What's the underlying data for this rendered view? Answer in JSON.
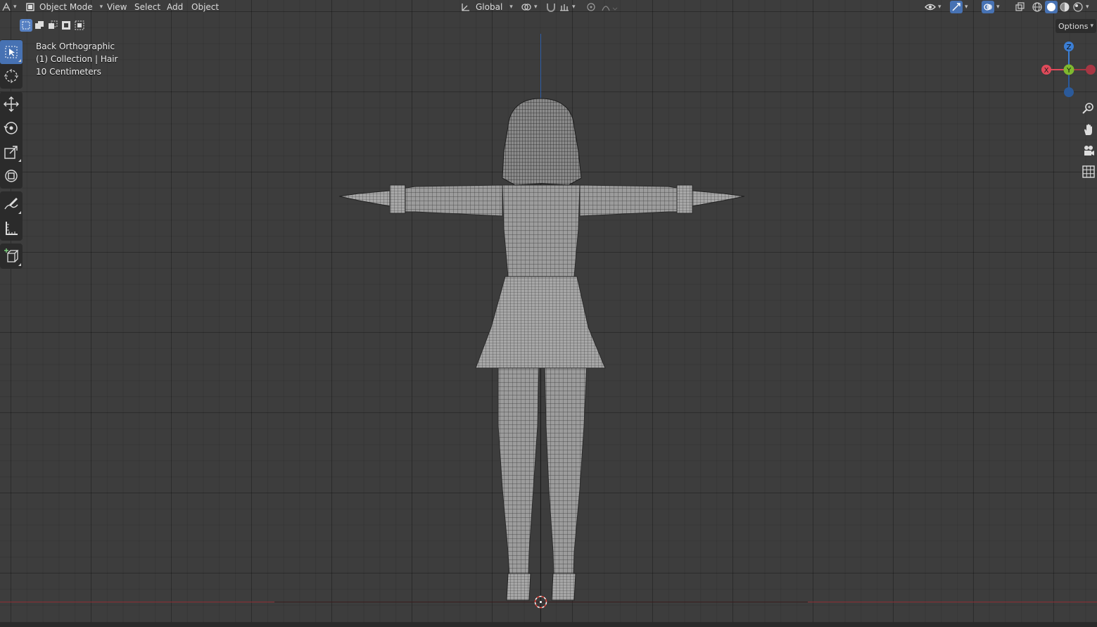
{
  "header": {
    "mode_label": "Object Mode",
    "menus": [
      "View",
      "Select",
      "Add",
      "Object"
    ],
    "transform_orientation": "Global"
  },
  "viewport": {
    "view_name": "Back Orthographic",
    "collection_info": "(1) Collection | Hair",
    "grid_scale": "10 Centimeters",
    "options_label": "Options"
  },
  "gizmo": {
    "x_label": "X",
    "y_label": "Y",
    "z_label": "Z",
    "colors": {
      "x": "#e04a5a",
      "y": "#7fb82f",
      "z": "#3b7ed4"
    }
  },
  "colors": {
    "background": "#3d3d3d",
    "active_tool": "#4772b3",
    "x_axis": "#b0393f",
    "z_axis": "#2f5fa8"
  },
  "tools": [
    "select-box-icon",
    "cursor-icon",
    "move-icon",
    "rotate-icon",
    "scale-icon",
    "transform-icon",
    "annotate-icon",
    "measure-icon",
    "add-cube-icon"
  ]
}
